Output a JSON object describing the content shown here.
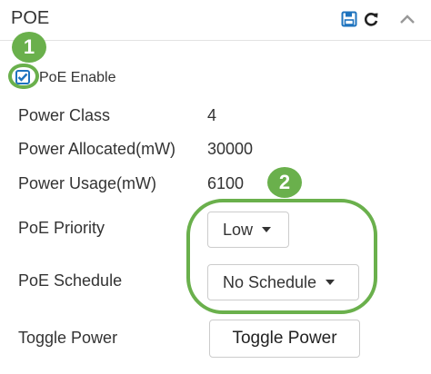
{
  "panel": {
    "title": "POE",
    "icons": {
      "save": "save-icon",
      "refresh": "refresh-icon",
      "collapse": "chevron-up-icon"
    }
  },
  "callouts": {
    "first": "1",
    "second": "2",
    "accent_color": "#6ab04c"
  },
  "poe_enable": {
    "label": "PoE Enable",
    "checked": true
  },
  "info": {
    "power_class_label": "Power Class",
    "power_class_value": "4",
    "power_allocated_label": "Power Allocated(mW)",
    "power_allocated_value": "30000",
    "power_usage_label": "Power Usage(mW)",
    "power_usage_value": "6100"
  },
  "settings": {
    "priority_label": "PoE Priority",
    "priority_value": "Low",
    "schedule_label": "PoE Schedule",
    "schedule_value": "No Schedule",
    "toggle_label": "Toggle Power",
    "toggle_button": "Toggle Power"
  },
  "colors": {
    "primary_blue": "#1e73be",
    "text": "#333333"
  }
}
